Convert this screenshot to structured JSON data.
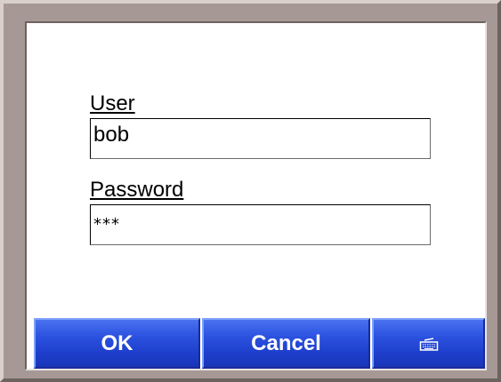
{
  "login": {
    "user_label": "User",
    "user_value": "bob",
    "password_label": "Password",
    "password_value": "***"
  },
  "buttons": {
    "ok_label": "OK",
    "cancel_label": "Cancel",
    "keyboard_icon": "keyboard-icon"
  },
  "colors": {
    "frame": "#a69894",
    "button_blue": "#2c52e0",
    "button_text": "#ffffff",
    "screen_bg": "#ffffff"
  }
}
